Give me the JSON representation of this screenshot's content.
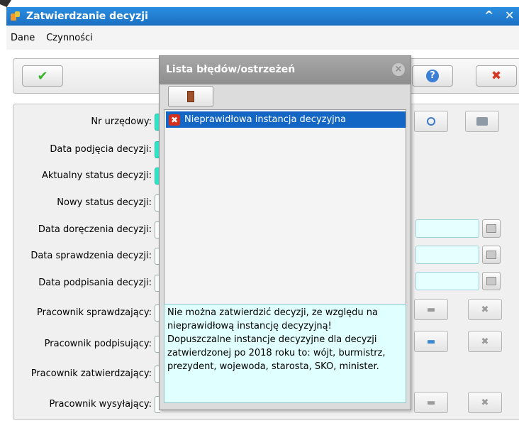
{
  "window": {
    "title": "Zatwierdzanie decyzji",
    "minimize_glyph": "^",
    "close_glyph": "✕"
  },
  "menu": [
    {
      "label": "Dane"
    },
    {
      "label": "Czynności"
    }
  ],
  "toolbar": {
    "confirm_icon": "check-icon",
    "help_icon": "help-icon",
    "cancel_icon": "cancel-icon",
    "help_glyph": "?",
    "cancel_glyph": "✖",
    "confirm_glyph": "✔"
  },
  "form": {
    "fields": [
      {
        "label": "Nr urzędowy:"
      },
      {
        "label": "Data podjęcia decyzji:"
      },
      {
        "label": "Aktualny status decyzji:"
      },
      {
        "label": "Nowy status decyzji:"
      },
      {
        "label": "Data doręczenia decyzji:"
      },
      {
        "label": "Data sprawdzenia decyzji:"
      },
      {
        "label": "Data podpisania decyzji:"
      },
      {
        "label": "Pracownik sprawdzający:"
      },
      {
        "label": "Pracownik podpisujący:"
      },
      {
        "label": "Pracownik zatwierdzający:"
      },
      {
        "label": "Pracownik wysyłający:"
      }
    ],
    "search_icon": "magnifier-icon",
    "print_icon": "printer-icon",
    "select_glyph": "▬",
    "clear_glyph": "✖"
  },
  "colors": {
    "title_bar": "#1a6fc2",
    "required_field": "#2ee6c8",
    "selection": "#1466c4",
    "message_bg": "#e0ffff"
  },
  "modal": {
    "title": "Lista błędów/ostrzeżeń",
    "close_glyph": "×",
    "errors": [
      {
        "text": "Nieprawidłowa instancja decyzyjna",
        "icon": "error-icon",
        "glyph": "✖"
      }
    ],
    "message_lines": [
      "Nie można zatwierdzić decyzji, ze względu na",
      "nieprawidłową instancję decyzyjną!",
      "Dopuszczalne instancje decyzyjne dla decyzji",
      "zatwierdzonej po 2018 roku to: wójt, burmistrz,",
      "prezydent, wojewoda, starosta, SKO, minister."
    ]
  }
}
